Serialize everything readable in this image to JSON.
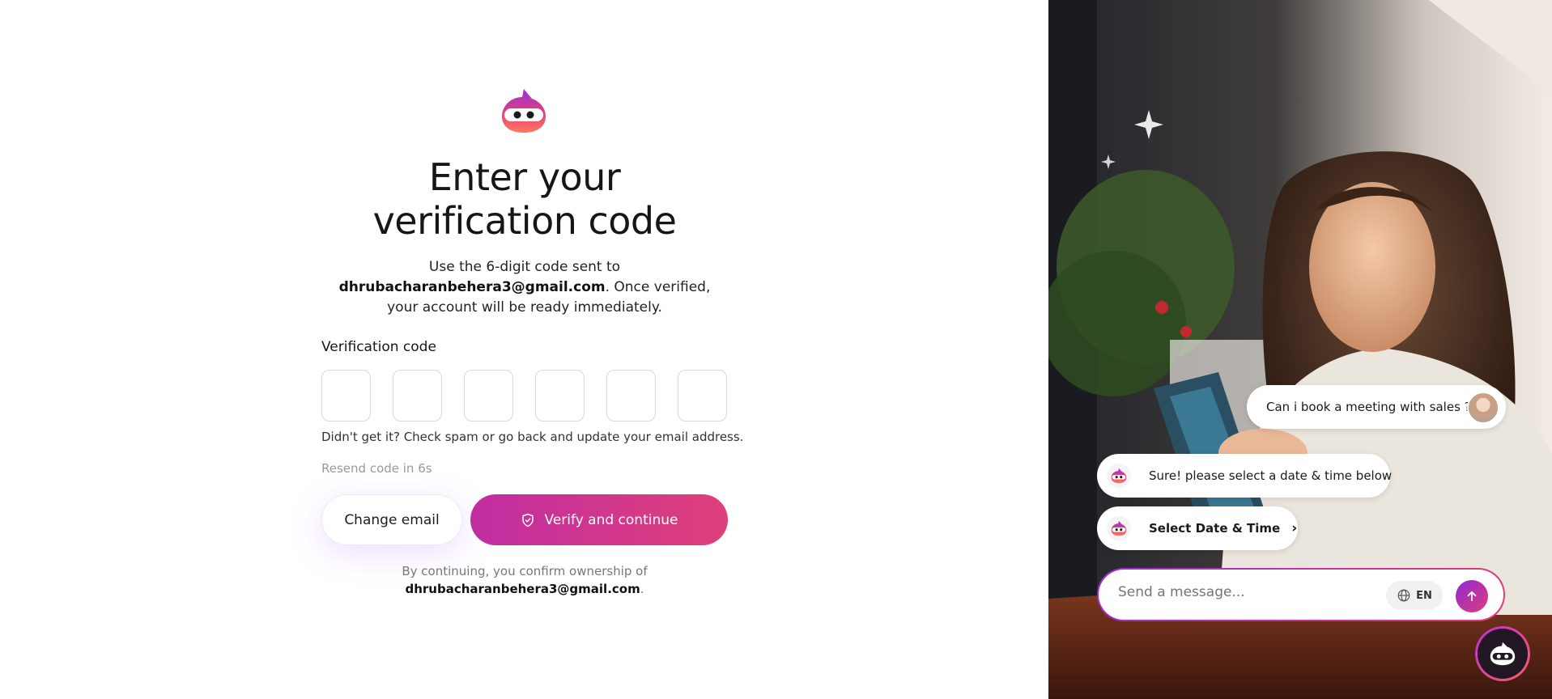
{
  "auth": {
    "title_line1": "Enter your",
    "title_line2": "verification code",
    "subtitle_prefix": "Use the 6-digit code sent to ",
    "email": "dhrubacharanbehera3@gmail.com",
    "subtitle_suffix": ". Once verified, your account will be ready immediately.",
    "code_label": "Verification code",
    "code_digits": [
      "",
      "",
      "",
      "",
      "",
      ""
    ],
    "hint": "Didn't get it? Check spam or go back and update your email address.",
    "resend": "Resend code in 6s",
    "change_email_label": "Change email",
    "verify_label": "Verify and continue",
    "consent_prefix": "By continuing, you confirm ownership of",
    "consent_email": "dhrubacharanbehera3@gmail.com",
    "consent_suffix": "."
  },
  "chat": {
    "user_message": "Can i book a meeting with sales ?",
    "bot_message": "Sure! please select a date & time below",
    "bot_action": "Select Date & Time",
    "input_placeholder": "Send a message...",
    "language": "EN"
  },
  "colors": {
    "accent_start": "#c02da2",
    "accent_end": "#e0407a"
  }
}
